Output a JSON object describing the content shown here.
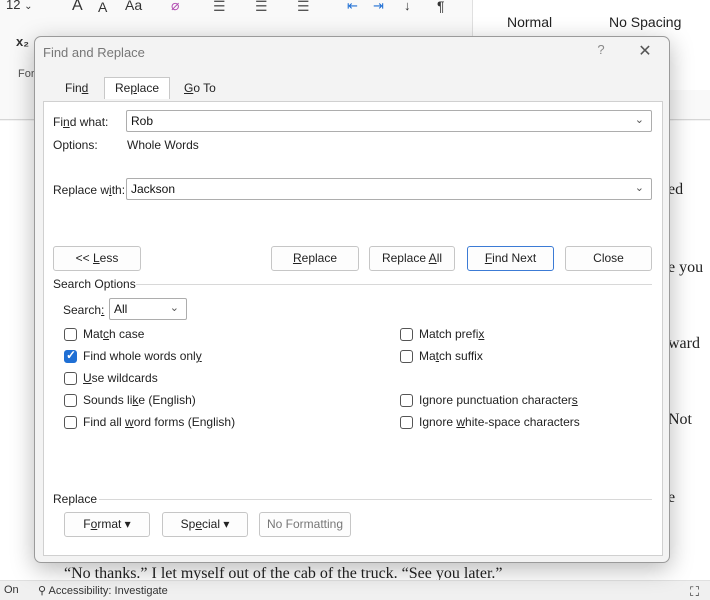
{
  "ribbon": {
    "font_size": "12",
    "grow_font": "A",
    "shrink_font": "A",
    "change_case": "Aa",
    "subscript": "x₂",
    "styles": {
      "normal": "Normal",
      "no_spacing": "No Spacing"
    },
    "tab_fragment": "For"
  },
  "document": {
    "line_1": "“No thanks.” I let myself out of the cab of the truck. “See you later.”",
    "edge_1": "ed",
    "edge_2": "e you",
    "edge_3": "ward",
    "edge_4": "Not",
    "edge_5": "e"
  },
  "status_bar": {
    "left_text": "On",
    "accessibility": "Accessibility: Investigate"
  },
  "dialog": {
    "title": "Find and Replace",
    "help": "?",
    "close": "✕",
    "tabs": [
      {
        "pre": "Fin",
        "key": "d",
        "post": ""
      },
      {
        "pre": "Re",
        "key": "p",
        "post": "lace"
      },
      {
        "pre": "",
        "key": "G",
        "post": "o To"
      }
    ],
    "find_label": {
      "pre": "Fi",
      "key": "n",
      "post": "d what:"
    },
    "find_value": "Rob",
    "options_label": "Options:",
    "options_value": "Whole Words",
    "replace_label": {
      "pre": "Replace w",
      "key": "i",
      "post": "th:"
    },
    "replace_value": "Jackson",
    "buttons": {
      "less": {
        "pre": "<< ",
        "key": "L",
        "post": "ess"
      },
      "replace": {
        "pre": "",
        "key": "R",
        "post": "eplace"
      },
      "replace_all": {
        "pre": "Replace ",
        "key": "A",
        "post": "ll"
      },
      "find_next": {
        "pre": "",
        "key": "F",
        "post": "ind Next"
      },
      "close": "Close"
    },
    "search_options": {
      "heading": "Search Options",
      "search_label": {
        "pre": "Search",
        "key": ":",
        "post": ""
      },
      "search_value": "All",
      "left": [
        {
          "pre": "Mat",
          "key": "c",
          "post": "h case",
          "checked": false
        },
        {
          "pre": "Find whole words onl",
          "key": "y",
          "post": "",
          "checked": true
        },
        {
          "pre": "",
          "key": "U",
          "post": "se wildcards",
          "checked": false
        },
        {
          "pre": "Sounds li",
          "key": "k",
          "post": "e (English)",
          "checked": false
        },
        {
          "pre": "Find all ",
          "key": "w",
          "post": "ord forms (English)",
          "checked": false
        }
      ],
      "right": [
        {
          "pre": "Match prefi",
          "key": "x",
          "post": "",
          "checked": false
        },
        {
          "pre": "Ma",
          "key": "t",
          "post": "ch suffix",
          "checked": false
        },
        {
          "pre": "Ignore punctuation character",
          "key": "s",
          "post": "",
          "checked": false
        },
        {
          "pre": "Ignore ",
          "key": "w",
          "post": "hite-space characters",
          "checked": false
        }
      ]
    },
    "replace_section": {
      "heading": "Replace",
      "format": {
        "pre": "F",
        "key": "o",
        "post": "rmat ▾"
      },
      "special": {
        "pre": "Sp",
        "key": "e",
        "post": "cial ▾"
      },
      "no_formatting": "No Formatting"
    }
  }
}
